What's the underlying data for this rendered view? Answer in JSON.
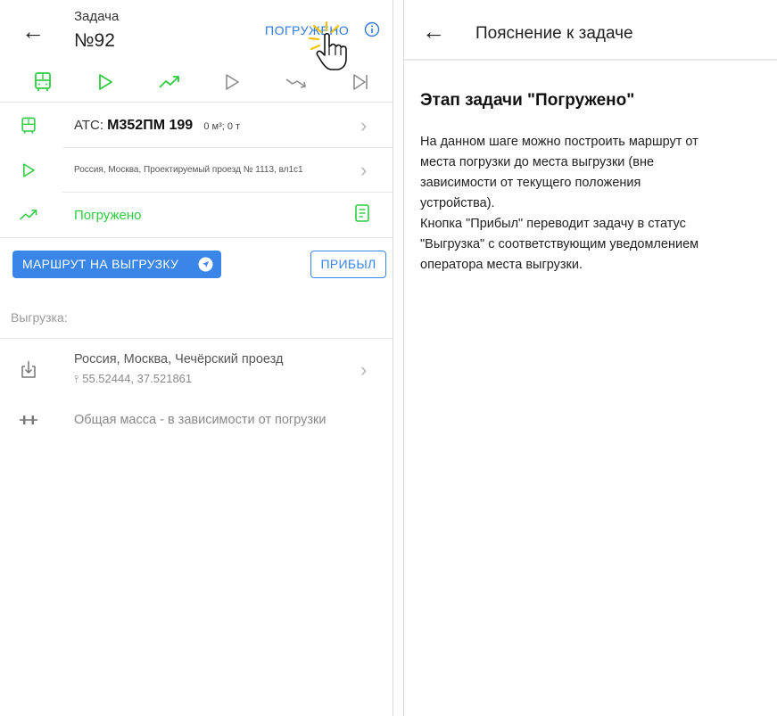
{
  "left": {
    "header": {
      "task_caption": "Задача",
      "task_number": "№92",
      "status_link": "ПОГРУЖЕНО"
    },
    "vehicle": {
      "label": "АТС:",
      "plate": "М352ПМ 199",
      "capacity": "0 м³; 0 т"
    },
    "origin_address": "Россия, Москва, Проектируемый проезд № 1113, вл1с1",
    "status_row": {
      "label": "Погружено"
    },
    "buttons": {
      "route": "МАРШРУТ НА ВЫГРУЗКУ",
      "arrived": "ПРИБЫЛ"
    },
    "unloading": {
      "section_label": "Выгрузка:",
      "address": "Россия, Москва, Чечёрский проезд",
      "coords": "55.52444, 37.521861",
      "mass": "Общая масса - в зависимости от погрузки"
    }
  },
  "right": {
    "title": "Пояснение к задаче",
    "heading": "Этап задачи \"Погружено\"",
    "body_lines": [
      "На данном шаге можно построить маршрут от",
      "места погрузки до места выгрузки (вне",
      "зависимости от текущего положения",
      "устройства).",
      "Кнопка \"Прибыл\" переводит задачу в статус",
      "\"Выгрузка\" с соответствующим уведомлением",
      "оператора места выгрузки."
    ]
  },
  "colors": {
    "accent_blue": "#3a86e8",
    "accent_green": "#2ecc40",
    "muted_gray": "#9a9a9a"
  },
  "icons": {
    "stepper": [
      "truck-icon",
      "play-icon",
      "trend-up-icon",
      "play-icon",
      "trend-down-icon",
      "skip-forward-icon"
    ]
  }
}
